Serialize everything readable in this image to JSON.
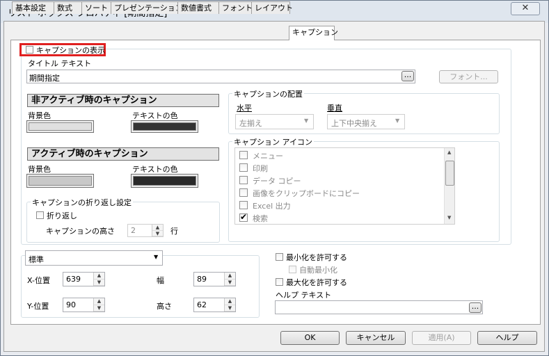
{
  "window": {
    "title": "リスト ボックス プロパティ [期間指定]",
    "close_glyph": "✕"
  },
  "tabs": [
    {
      "label": "基本設定"
    },
    {
      "label": "数式"
    },
    {
      "label": "ソート"
    },
    {
      "label": "プレゼンテーション"
    },
    {
      "label": "数値書式"
    },
    {
      "label": "フォント"
    },
    {
      "label": "レイアウト"
    },
    {
      "label": "キャプション"
    }
  ],
  "caption": {
    "show_label": "キャプションの表示",
    "title_text_label": "タイトル テキスト",
    "title_text_value": "期間指定",
    "ellipsis": "...",
    "font_button": "フォント...",
    "inactive_header": "非アクティブ時のキャプション",
    "active_header": "アクティブ時のキャプション",
    "bg_color_label": "背景色",
    "text_color_label": "テキストの色",
    "colors": {
      "inactive_bg": "#e0e0e0",
      "inactive_text": "#333333",
      "active_bg": "#c8c8c8",
      "active_text": "#2a2a2a"
    },
    "wrap_group_label": "キャプションの折り返し設定",
    "wrap_label": "折り返し",
    "height_label": "キャプションの高さ",
    "height_value": "2",
    "height_unit": "行",
    "align_group_label": "キャプションの配置",
    "horizontal_label": "水平",
    "vertical_label": "垂直",
    "horizontal_value": "左揃え",
    "vertical_value": "上下中央揃え",
    "icons_group_label": "キャプション アイコン",
    "icons": [
      {
        "label": "メニュー",
        "checked": false
      },
      {
        "label": "印刷",
        "checked": false
      },
      {
        "label": "データ コピー",
        "checked": false
      },
      {
        "label": "画像をクリップボードにコピー",
        "checked": false
      },
      {
        "label": "Excel 出力",
        "checked": false
      },
      {
        "label": "検索",
        "checked": true
      }
    ]
  },
  "position": {
    "mode_value": "標準",
    "x_label": "X-位置",
    "x_value": "639",
    "y_label": "Y-位置",
    "y_value": "90",
    "width_label": "幅",
    "width_value": "89",
    "height_label": "高さ",
    "height_value": "62",
    "allow_minimize": "最小化を許可する",
    "auto_minimize": "自動最小化",
    "allow_maximize": "最大化を許可する",
    "help_text_label": "ヘルプ テキスト"
  },
  "footer": {
    "ok": "OK",
    "cancel": "キャンセル",
    "apply": "適用(A)",
    "help": "ヘルプ"
  },
  "highlight_color": "#e02020"
}
